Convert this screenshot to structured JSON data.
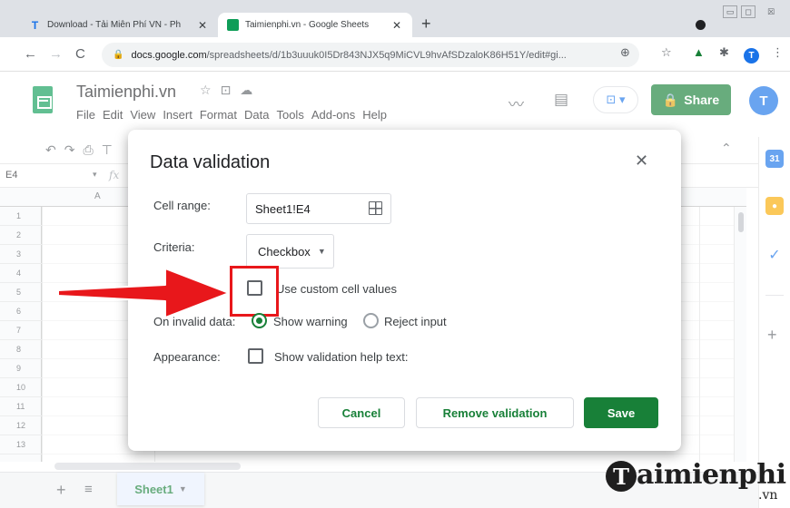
{
  "browser": {
    "tabs": [
      {
        "title": "Download - Tải Miễn Phí VN - Ph",
        "favicon": "T"
      },
      {
        "title": "Taimienphi.vn - Google Sheets",
        "favicon": "sheets-icon"
      }
    ],
    "url_host": "docs.google.com",
    "url_path": "/spreadsheets/d/1b3uuuk0I5Dr843NJX5q9MiCVL9hvAfSDzaloK86H51Y/edit#gi...",
    "avatar": "T"
  },
  "sheets": {
    "doc_title": "Taimienphi.vn",
    "menu": [
      "File",
      "Edit",
      "View",
      "Insert",
      "Format",
      "Data",
      "Tools",
      "Add-ons",
      "Help"
    ],
    "share_label": "Share",
    "avatar": "T",
    "name_box": "E4",
    "fx": "fx",
    "column_a": "A",
    "rows": [
      "1",
      "2",
      "3",
      "4",
      "5",
      "6",
      "7",
      "8",
      "9",
      "10",
      "11",
      "12",
      "13"
    ],
    "sheet_tab": "Sheet1",
    "colors": {
      "brand_green": "#188038",
      "highlight_red": "#e8171b",
      "arrow_red": "#e8171b"
    }
  },
  "dialog": {
    "title": "Data validation",
    "cell_range_label": "Cell range:",
    "cell_range_value": "Sheet1!E4",
    "criteria_label": "Criteria:",
    "criteria_value": "Checkbox",
    "custom_values_label": "Use custom cell values",
    "custom_values_checked": false,
    "invalid_label": "On invalid data:",
    "show_warning": "Show warning",
    "reject_input": "Reject input",
    "invalid_selected": "show_warning",
    "appearance_label": "Appearance:",
    "help_text_label": "Show validation help text:",
    "cancel": "Cancel",
    "remove": "Remove validation",
    "save": "Save"
  },
  "watermark": {
    "letter": "T",
    "text": "aimienphi",
    "suffix": ".vn"
  }
}
